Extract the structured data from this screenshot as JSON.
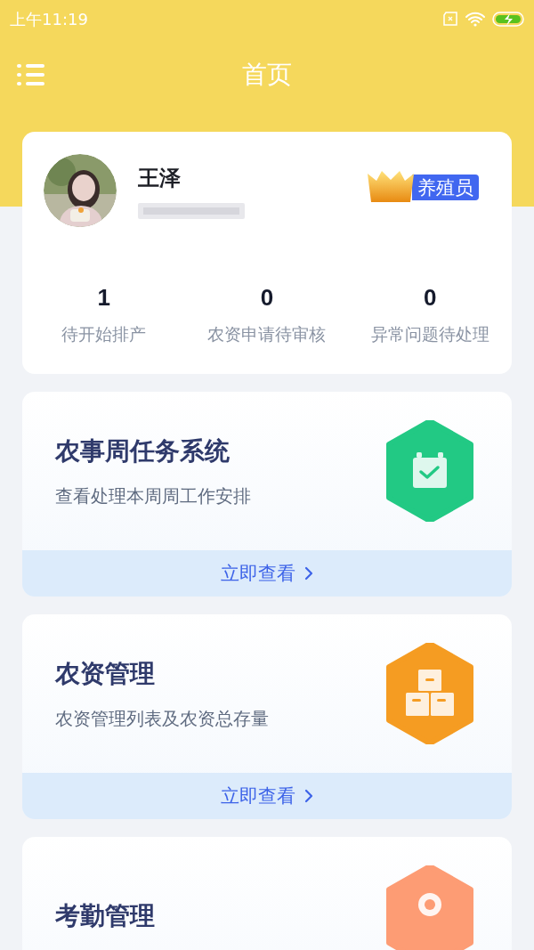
{
  "status_bar": {
    "time": "上午11:19"
  },
  "header": {
    "title": "首页"
  },
  "profile": {
    "name": "王泽",
    "role": "养殖员",
    "stats": [
      {
        "value": "1",
        "label": "待开始排产"
      },
      {
        "value": "0",
        "label": "农资申请待审核"
      },
      {
        "value": "0",
        "label": "异常问题待处理"
      }
    ]
  },
  "modules": [
    {
      "kind": "calendar",
      "title": "农事周任务系统",
      "subtitle": "查看处理本周周工作安排",
      "action": "立即查看",
      "color": "#22c984"
    },
    {
      "kind": "boxes",
      "title": "农资管理",
      "subtitle": "农资管理列表及农资总存量",
      "action": "立即查看",
      "color": "#f59c22"
    },
    {
      "kind": "location",
      "title": "考勤管理",
      "color": "#fd9c74"
    }
  ]
}
